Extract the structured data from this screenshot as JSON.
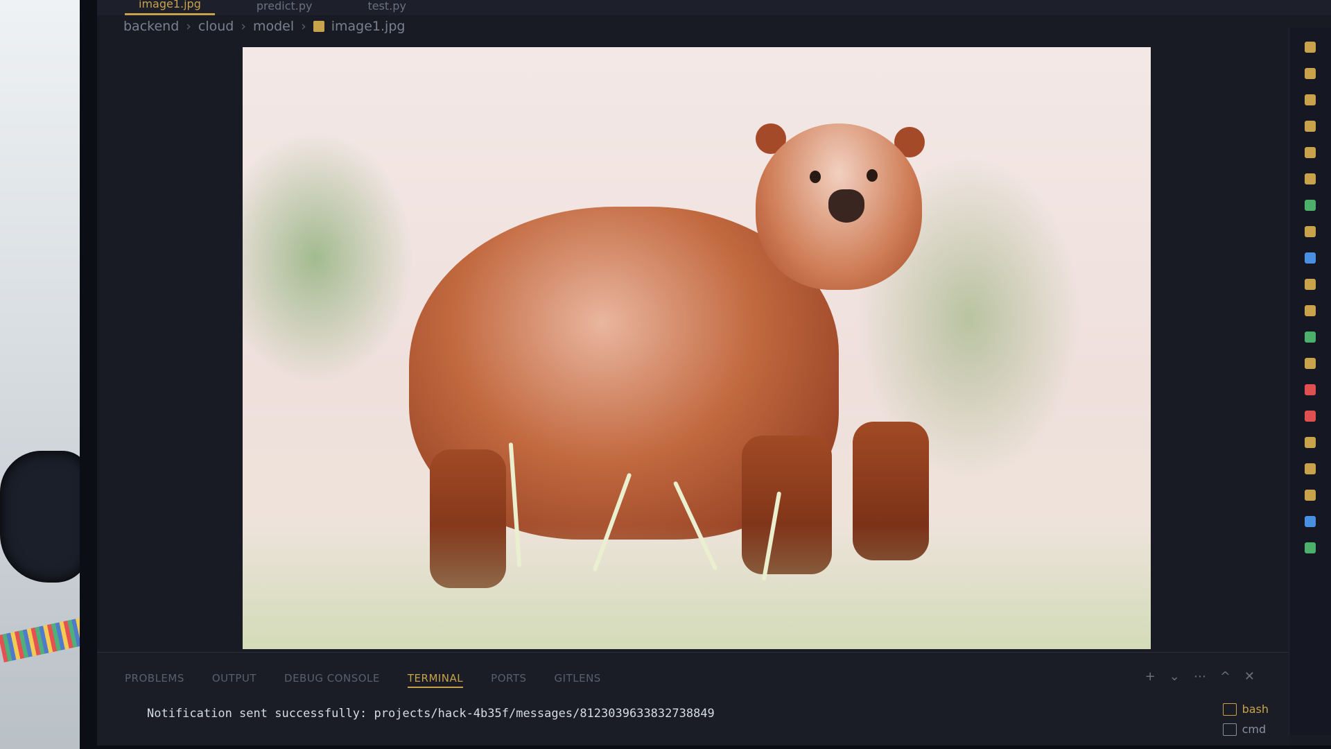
{
  "editor": {
    "tabs": [
      {
        "label": "image1.jpg",
        "active": true
      },
      {
        "label": "predict.py",
        "active": false
      },
      {
        "label": "test.py",
        "active": false
      }
    ],
    "breadcrumb": [
      "backend",
      "cloud",
      "model",
      "image1.jpg"
    ]
  },
  "panel": {
    "tabs": [
      {
        "label": "PROBLEMS",
        "active": false
      },
      {
        "label": "OUTPUT",
        "active": false
      },
      {
        "label": "DEBUG CONSOLE",
        "active": false
      },
      {
        "label": "TERMINAL",
        "active": true
      },
      {
        "label": "PORTS",
        "active": false
      },
      {
        "label": "GITLENS",
        "active": false
      }
    ],
    "actions": [
      "+",
      "⌄",
      "⋯",
      "^",
      "✕"
    ],
    "terminal_output": "Notification sent successfully: projects/hack-4b35f/messages/8123039633832738849",
    "terminals": [
      {
        "label": "bash",
        "active": true
      },
      {
        "label": "cmd",
        "active": false
      }
    ]
  },
  "colors": {
    "accent": "#c9a34b",
    "background": "#181a24"
  },
  "explorer_icon_colors": [
    "#c9a34b",
    "#c9a34b",
    "#c9a34b",
    "#c9a34b",
    "#c9a34b",
    "#c9a34b",
    "#4caf6a",
    "#c9a34b",
    "#4a90e2",
    "#c9a34b",
    "#c9a34b",
    "#4caf6a",
    "#c9a34b",
    "#e05050",
    "#e05050",
    "#c9a34b",
    "#c9a34b",
    "#c9a34b",
    "#4a90e2",
    "#4caf6a"
  ]
}
